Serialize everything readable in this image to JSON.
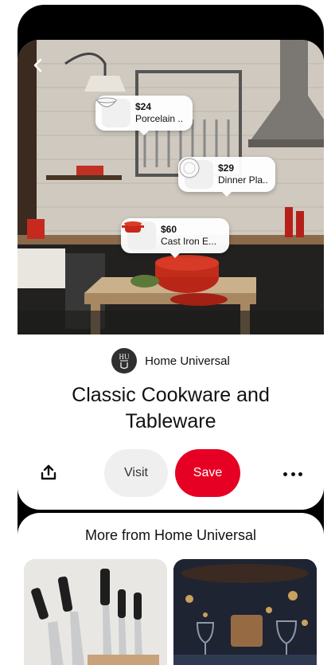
{
  "pin": {
    "brand_name": "Home Universal",
    "brand_logo_letters": "HU",
    "title": "Classic Cookware and Tableware",
    "visit_label": "Visit",
    "save_label": "Save"
  },
  "product_tags": [
    {
      "price": "$24",
      "name": "Porcelain ..",
      "icon": "bowl-icon"
    },
    {
      "price": "$29",
      "name": "Dinner Pla..",
      "icon": "plate-icon"
    },
    {
      "price": "$60",
      "name": "Cast Iron E...",
      "icon": "dutch-oven-icon"
    }
  ],
  "more_section": {
    "title": "More from Home Universal"
  },
  "icons": {
    "back": "chevron-left-icon",
    "share": "share-icon",
    "more": "more-options-icon"
  },
  "colors": {
    "save": "#e60023",
    "visit_bg": "#efefef"
  }
}
